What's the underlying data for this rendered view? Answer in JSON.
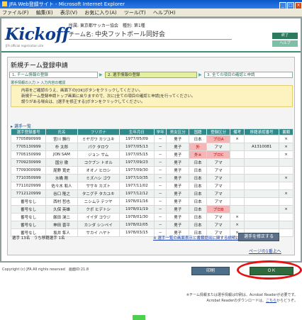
{
  "window": {
    "title": "JFA Web登録サイト - Microsoft Internet Explorer"
  },
  "menu": [
    "ファイル(F)",
    "編集(E)",
    "表示(V)",
    "お気に入り(A)",
    "ツール(T)",
    "ヘルプ(H)"
  ],
  "header": {
    "logo": "Kickoff",
    "logo_sub": "JFA official registration site",
    "org_label": "所属: 東京都サッカー協会　種別: 第1種",
    "team_label": "チーム名",
    "team_name": "中央フットボール同好会",
    "end_button": "終了",
    "help_button": "ヘルプ"
  },
  "main": {
    "title": "新規チーム登録申請",
    "steps": [
      "1. チーム情報の登録",
      "2. 選手情報の登録",
      "3. 全ての項目の確認と申請"
    ],
    "breadcrumb": "選手情報の入力 > 入力内容の確認",
    "notice": [
      "内容をご確認のうえ、画面下の[OK]ボタンをクリックしてください。",
      "新規チーム登録申請トップ画面に戻りますので、次に[全ての項目の確認と申請]を行ってください。",
      "誤りがある場合は、[選手を修正する]ボタンをクリックしてください。"
    ],
    "section_title": "選手一覧"
  },
  "table": {
    "columns": [
      "選手登録番号",
      "氏名",
      "フリガナ",
      "生年月日",
      "学年",
      "男女区分",
      "国籍",
      "登録区分",
      "備考",
      "移籍承認番号",
      "書類"
    ],
    "rows": [
      [
        "7705890999",
        "宮川 勝行",
        "ミヤガワ カツユキ",
        "1977/05/09",
        "－",
        "男子",
        "日本",
        "プロA",
        "×",
        "",
        "×"
      ],
      [
        "7705130999",
        "朴 太郎",
        "パク タロウ",
        "1977/05/13",
        "－",
        "男子",
        "外",
        "アマ",
        "",
        "A1310081",
        "×"
      ],
      [
        "7705150999",
        "JON SAM",
        "ジョン サム",
        "1977/05/15",
        "－",
        "男子",
        "外※",
        "プロC",
        "",
        "",
        "×"
      ],
      [
        "7709230999",
        "国分 徹",
        "コクブン トオル",
        "1977/09/23",
        "－",
        "男子",
        "日本",
        "アマ",
        "",
        "",
        ""
      ],
      [
        "7709300999",
        "尾野 寛史",
        "オオノ ヒロシ",
        "1977/09/30",
        "－",
        "男子",
        "日本",
        "アマ",
        "",
        "",
        ""
      ],
      [
        "7710350999",
        "水橋 剛",
        "ミズハシ ゴウ",
        "1977/10/35",
        "－",
        "男子",
        "日本",
        "アマ",
        "",
        "",
        "×"
      ],
      [
        "7711020999",
        "佐々木 和人",
        "ササキ カズト",
        "1977/11/02",
        "－",
        "男子",
        "日本",
        "アマ",
        "",
        "",
        ""
      ],
      [
        "7712120999",
        "谷口 隆之",
        "タニグチ タカユキ",
        "1977/12/12",
        "－",
        "男子",
        "日本",
        "アマ",
        "",
        "",
        "×"
      ],
      [
        "番号なし",
        "西村 哲也",
        "ニシムラ テツヤ",
        "1978/01/16",
        "－",
        "男子",
        "日本",
        "アマ",
        "",
        "",
        ""
      ],
      [
        "番号なし",
        "久保 英雄",
        "クボ ヒデトシ",
        "1978/01/19",
        "－",
        "男子",
        "日本",
        "プロB",
        "",
        "",
        "×"
      ],
      [
        "番号なし",
        "飯田 滉二",
        "イイダ コウジ",
        "1978/01/30",
        "－",
        "男子",
        "日本",
        "アマ",
        "×",
        "",
        ""
      ],
      [
        "番号なし",
        "神田 晋平",
        "カンダ シンペイ",
        "1978/02/05",
        "－",
        "男子",
        "日本",
        "アマ",
        "×",
        "",
        ""
      ],
      [
        "番号なし",
        "坂井 隼人",
        "サカイ ハヤト",
        "1978/03/15",
        "－",
        "男子",
        "日本",
        "アマ",
        "×",
        "",
        ""
      ]
    ]
  },
  "totals": "選手 13名　うち移籍選手 1名",
  "policy_link": "※ 選手一覧の画面表示と書類提出に関する説明はこちら",
  "confirm_button": "選手を修正する",
  "page_top": "ページの1番上へ",
  "footer": {
    "copyright": "Copyright (c) JFA All rights reserved　画面ID:21.8",
    "print_button": "印刷",
    "ok_button": "ＯＫ",
    "note_line1": "※チーム情報または選手情報は印刷は、Acrobat Readerが必要です。",
    "note_line2_prefix": "Acrobat Readerのダウンロードは、",
    "note_link": "こちら",
    "note_line2_suffix": "からどうぞ。"
  },
  "colors": {
    "header_bar": "#2f8b8c",
    "ok_highlight": "#e41111",
    "step_active": "#e4f0a0"
  }
}
